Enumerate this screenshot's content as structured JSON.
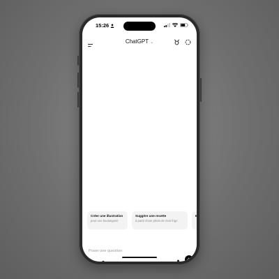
{
  "status_bar": {
    "time": "15:26"
  },
  "header": {
    "title": "ChatGPT",
    "icons": [
      "menu-icon",
      "chevron-down-icon",
      "gpt-icon",
      "new-chat-icon"
    ]
  },
  "suggestions": [
    {
      "title": "Créer une illustration",
      "subtitle": "pour une boulangerie"
    },
    {
      "title": "Suggère une recette",
      "subtitle": "à partir d'une photo de mon frigo"
    },
    {
      "title": "E",
      "subtitle": ""
    }
  ],
  "composer": {
    "placeholder": "Poser une question",
    "icons": [
      "plus-icon",
      "tune-icon",
      "mic-icon",
      "voice-mode-icon"
    ]
  }
}
